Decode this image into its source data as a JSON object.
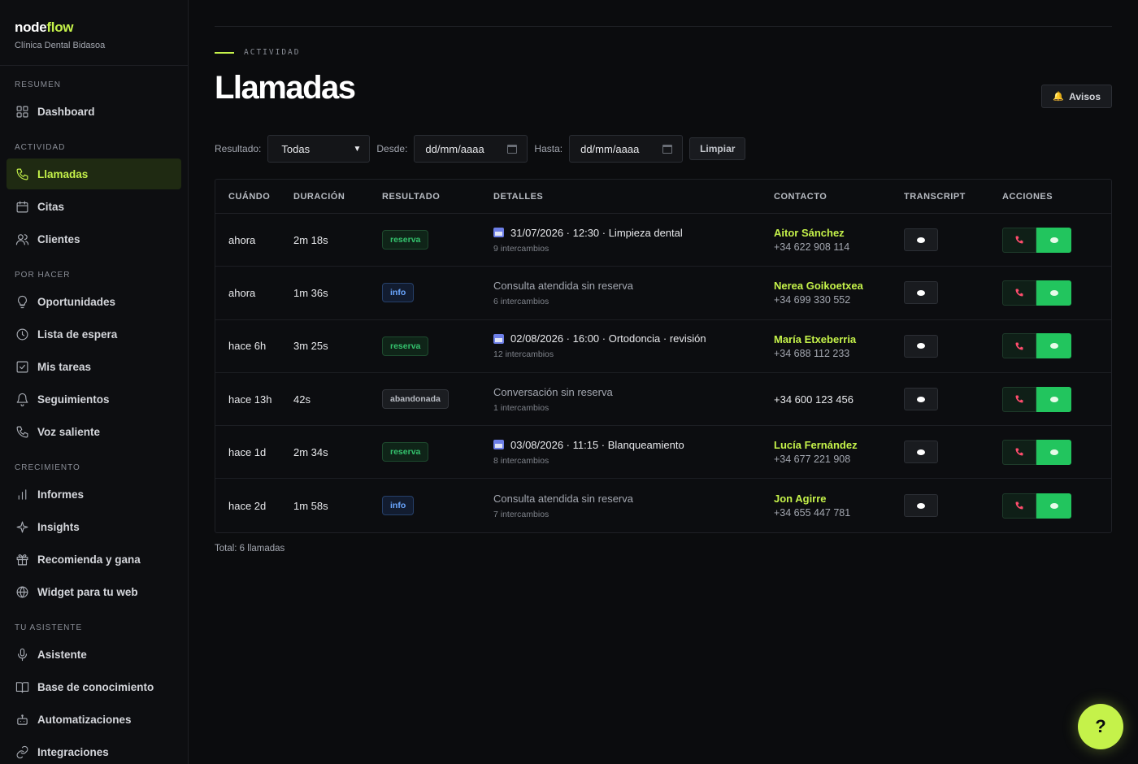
{
  "brand": {
    "name_part1": "node",
    "name_part2": "flow",
    "subtitle": "Clínica Dental Bidasoa",
    "accent_color": "#c5f24a"
  },
  "sidebar": {
    "sections": [
      {
        "heading": "RESUMEN",
        "items": [
          {
            "label": "Dashboard",
            "icon": "grid-icon"
          }
        ]
      },
      {
        "heading": "ACTIVIDAD",
        "items": [
          {
            "label": "Llamadas",
            "icon": "phone-icon",
            "active": true
          },
          {
            "label": "Citas",
            "icon": "calendar-icon"
          },
          {
            "label": "Clientes",
            "icon": "users-icon"
          }
        ]
      },
      {
        "heading": "POR HACER",
        "items": [
          {
            "label": "Oportunidades",
            "icon": "lightbulb-icon"
          },
          {
            "label": "Lista de espera",
            "icon": "clock-icon"
          },
          {
            "label": "Mis tareas",
            "icon": "checkbox-icon"
          },
          {
            "label": "Seguimientos",
            "icon": "bell-icon"
          },
          {
            "label": "Voz saliente",
            "icon": "phone-outgoing-icon"
          }
        ]
      },
      {
        "heading": "CRECIMIENTO",
        "items": [
          {
            "label": "Informes",
            "icon": "bar-chart-icon"
          },
          {
            "label": "Insights",
            "icon": "sparkle-icon"
          },
          {
            "label": "Recomienda y gana",
            "icon": "gift-icon"
          },
          {
            "label": "Widget para tu web",
            "icon": "globe-icon"
          }
        ]
      },
      {
        "heading": "TU ASISTENTE",
        "items": [
          {
            "label": "Asistente",
            "icon": "mic-icon"
          },
          {
            "label": "Base de conocimiento",
            "icon": "book-icon"
          },
          {
            "label": "Automatizaciones",
            "icon": "robot-icon"
          },
          {
            "label": "Integraciones",
            "icon": "link-icon"
          }
        ]
      }
    ]
  },
  "header": {
    "eyebrow": "ACTIVIDAD",
    "title": "Llamadas",
    "avisos_label": "Avisos",
    "avisos_icon": "🔔"
  },
  "filters": {
    "resultado_label": "Resultado:",
    "resultado_value": "Todas",
    "desde_label": "Desde:",
    "desde_placeholder": "dd/mm/aaaa",
    "hasta_label": "Hasta:",
    "hasta_placeholder": "dd/mm/aaaa",
    "clear_label": "Limpiar"
  },
  "table": {
    "columns": [
      "CUÁNDO",
      "DURACIÓN",
      "RESULTADO",
      "DETALLES",
      "CONTACTO",
      "TRANSCRIPT",
      "ACCIONES"
    ],
    "rows": [
      {
        "when": "ahora",
        "duration": "2m 18s",
        "result": "reserva",
        "detail": "31/07/2026 · 12:30 · Limpieza dental",
        "detail_has_calendar": true,
        "exchanges": "9 intercambios",
        "contact_name": "Aitor Sánchez",
        "contact_phone": "+34 622 908 114"
      },
      {
        "when": "ahora",
        "duration": "1m 36s",
        "result": "info",
        "detail": "Consulta atendida sin reserva",
        "detail_has_calendar": false,
        "exchanges": "6 intercambios",
        "contact_name": "Nerea Goikoetxea",
        "contact_phone": "+34 699 330 552"
      },
      {
        "when": "hace 6h",
        "duration": "3m 25s",
        "result": "reserva",
        "detail": "02/08/2026 · 16:00 · Ortodoncia · revisión",
        "detail_has_calendar": true,
        "exchanges": "12 intercambios",
        "contact_name": "María Etxeberria",
        "contact_phone": "+34 688 112 233"
      },
      {
        "when": "hace 13h",
        "duration": "42s",
        "result": "abandonada",
        "detail": "Conversación sin reserva",
        "detail_has_calendar": false,
        "exchanges": "1 intercambios",
        "contact_name": "",
        "contact_phone": "+34 600 123 456"
      },
      {
        "when": "hace 1d",
        "duration": "2m 34s",
        "result": "reserva",
        "detail": "03/08/2026 · 11:15 · Blanqueamiento",
        "detail_has_calendar": true,
        "exchanges": "8 intercambios",
        "contact_name": "Lucía Fernández",
        "contact_phone": "+34 677 221 908"
      },
      {
        "when": "hace 2d",
        "duration": "1m 58s",
        "result": "info",
        "detail": "Consulta atendida sin reserva",
        "detail_has_calendar": false,
        "exchanges": "7 intercambios",
        "contact_name": "Jon Agirre",
        "contact_phone": "+34 655 447 781"
      }
    ]
  },
  "total": "Total: 6 llamadas",
  "help_label": "?"
}
